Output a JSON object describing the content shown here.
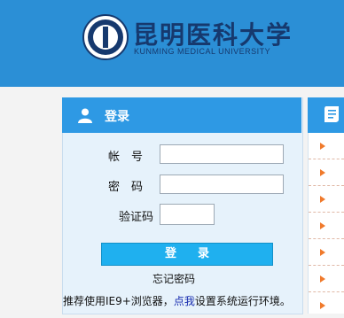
{
  "header": {
    "university_name_cn": "昆明医科大学",
    "university_name_en": "KUNMING MEDICAL UNIVERSITY"
  },
  "login": {
    "title": "登录",
    "account_label": "帐　号",
    "password_label": "密　码",
    "captcha_label": "验证码",
    "account_value": "",
    "password_value": "",
    "captcha_value": "",
    "submit_label": "登录",
    "forgot_label": "忘记密码",
    "tip_prefix": "推荐使用IE9+浏览器，",
    "tip_link": "点我",
    "tip_suffix": "设置系统运行环境。"
  },
  "colors": {
    "header_blue": "#2b8fd6",
    "panel_head_blue": "#2e99e4",
    "button_blue": "#1fb0ef",
    "arrow_orange": "#f07a2c"
  }
}
